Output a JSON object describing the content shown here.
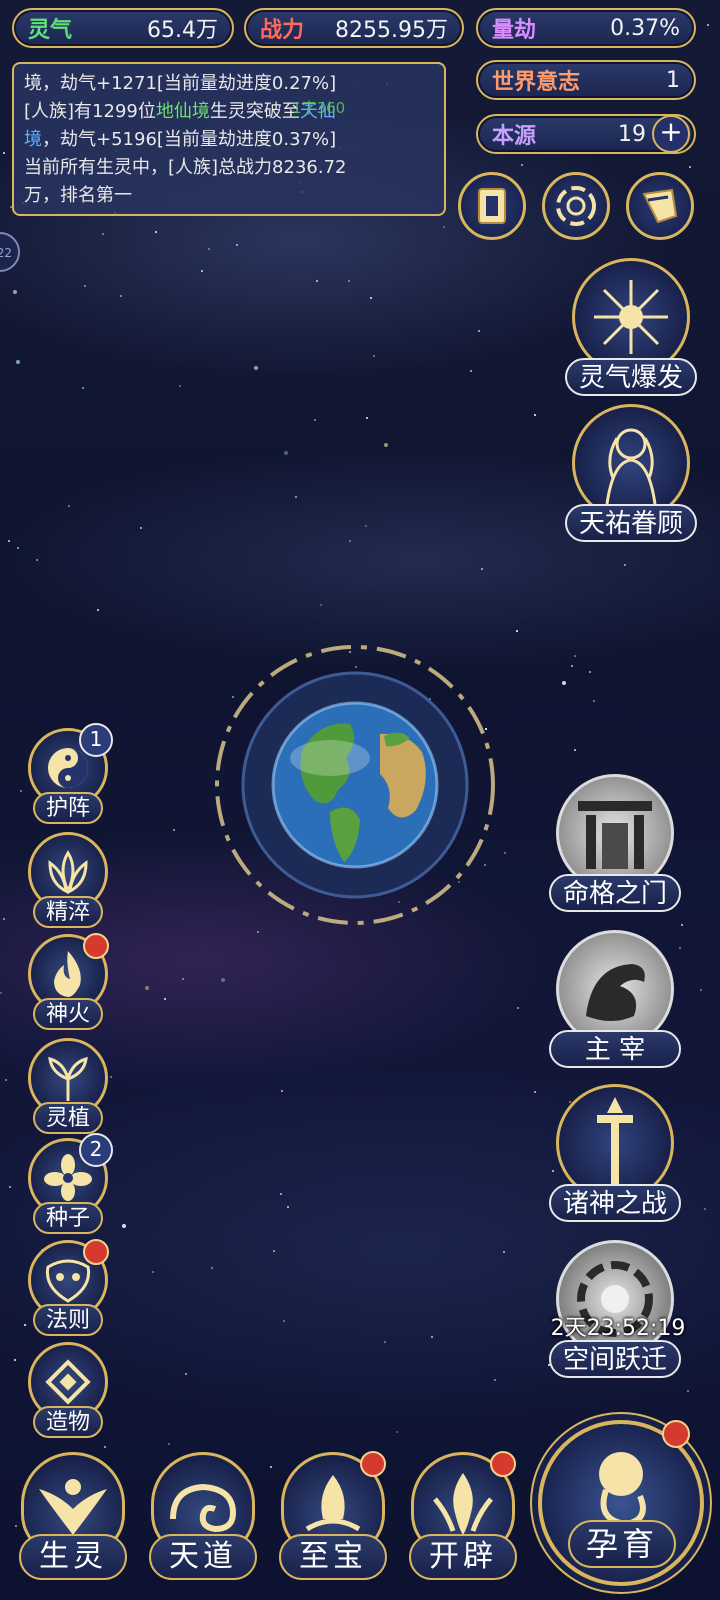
{
  "colors": {
    "gold": "#d9b65e",
    "panel": "#1b2550",
    "background": "#12173a",
    "red_dot": "#d43a2e",
    "green_text": "#6fe06f",
    "blue_text": "#5fb0ff"
  },
  "stats": {
    "lingqi": {
      "label": "灵气",
      "value": "65.4万",
      "label_color": "#5fe07a"
    },
    "zhanli": {
      "label": "战力",
      "value": "8255.95万",
      "label_color": "#ff6a5c"
    },
    "liangjie": {
      "label": "量劫",
      "value": "0.37%",
      "label_color": "#d98cff"
    },
    "shijie": {
      "label": "世界意志",
      "value": "1",
      "label_color": "#ff9b6a"
    },
    "benyuan": {
      "label": "本源",
      "value": "19",
      "label_color": "#c6a0ff"
    }
  },
  "log": {
    "line1_a": "境，劫气+1271[当前量劫进度0.27%]",
    "line2_a": "[人族]有1299位",
    "line2_green": "地仙境",
    "line2_b": "生灵突破至",
    "line2_blue": "天仙",
    "line3_blue": "境",
    "line3_b": "，劫气+5196[当前量劫进度0.37%]",
    "line4": "当前所有生灵中，[人族]总战力8236.72",
    "line5": "万，排名第一",
    "floating_tag": "1字360"
  },
  "side_tab": "22",
  "right_buttons": [
    {
      "label": "灵气爆发"
    },
    {
      "label": "天祐眷顾"
    },
    {
      "label": "命格之门"
    },
    {
      "label": "主 宰"
    },
    {
      "label": "诸神之战"
    },
    {
      "label": "空间跃迁"
    }
  ],
  "timer": "2天23:52:19",
  "left_buttons": [
    {
      "label": "护阵",
      "badge": "1"
    },
    {
      "label": "精淬"
    },
    {
      "label": "神火"
    },
    {
      "label": "灵植"
    },
    {
      "label": "种子",
      "badge": "2"
    },
    {
      "label": "法则"
    },
    {
      "label": "造物"
    }
  ],
  "bottom_nav": [
    {
      "label": "生灵"
    },
    {
      "label": "天道"
    },
    {
      "label": "至宝"
    },
    {
      "label": "开辟"
    }
  ],
  "yunyu": {
    "label": "孕育"
  },
  "icons": {
    "plus": "plus-icon",
    "card": "card-icon",
    "vortex": "vortex-icon",
    "scroll": "scroll-icon",
    "planet": "earth-planet"
  }
}
